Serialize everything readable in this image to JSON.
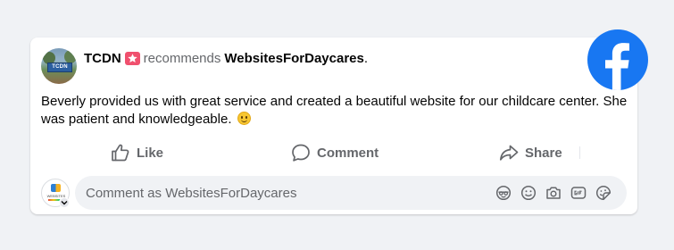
{
  "post": {
    "author": "TCDN",
    "avatar_sign": "TCDN",
    "recommends_label": "recommends",
    "target": "WebsitesForDaycares",
    "period": ".",
    "body": "Beverly provided us with great service and created a beautiful website for our childcare center.  She was patient and knowledgeable.",
    "emoji": "smiling-face"
  },
  "actions": {
    "like_label": "Like",
    "comment_label": "Comment",
    "share_label": "Share"
  },
  "comment_box": {
    "placeholder": "Comment as WebsitesForDaycares",
    "commenter_avatar_text": "WEBSITES",
    "icons": [
      "avatar-sticker-icon",
      "emoji-icon",
      "camera-icon",
      "gif-icon",
      "sticker-icon"
    ]
  },
  "brand": {
    "logo": "facebook-logo-icon",
    "facebook_blue": "#1877f2",
    "recommend_badge_color": "#f0506e"
  }
}
